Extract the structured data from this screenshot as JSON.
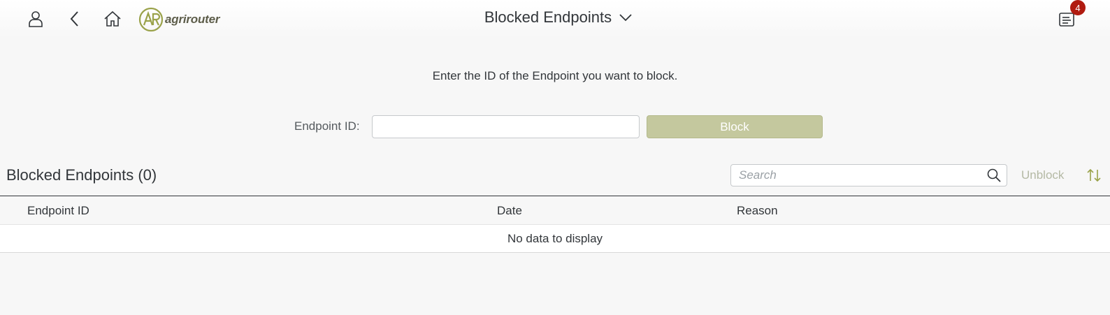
{
  "header": {
    "title": "Blocked Endpoints",
    "logo_text": "agrirouter",
    "notification_count": "4",
    "icons": [
      "user-icon",
      "back-icon",
      "home-icon",
      "chevron-down-icon",
      "notifications-icon"
    ]
  },
  "block_form": {
    "instruction": "Enter the ID of the Endpoint you want to block.",
    "endpoint_label": "Endpoint ID:",
    "endpoint_value": "",
    "block_label": "Block"
  },
  "list": {
    "title": "Blocked Endpoints (0)",
    "search_placeholder": "Search",
    "unblock_label": "Unblock",
    "columns": [
      "Endpoint ID",
      "Date",
      "Reason"
    ],
    "empty_text": "No data to display"
  },
  "colors": {
    "accent": "#c4c89e",
    "badge": "#b01b10",
    "logo": "#9aa24a"
  }
}
